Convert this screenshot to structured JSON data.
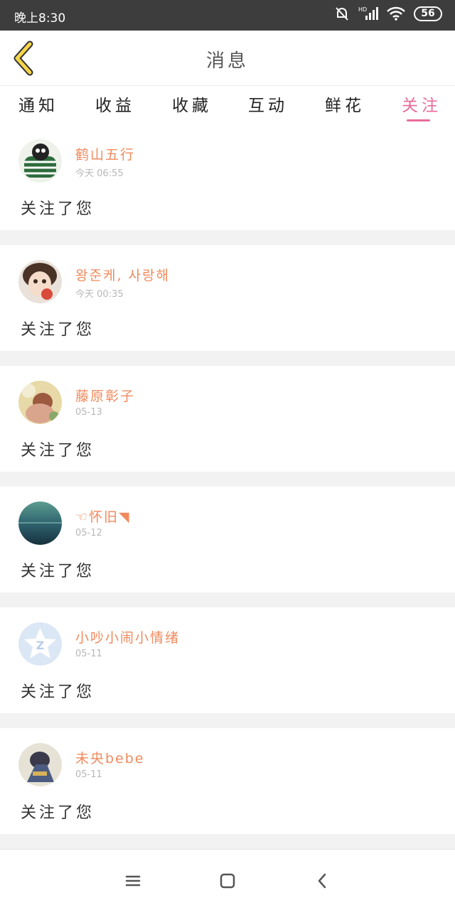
{
  "status_bar": {
    "time": "晚上8:30",
    "network": "HD",
    "battery": "56"
  },
  "header": {
    "title": "消息"
  },
  "tabs": [
    {
      "label": "通知"
    },
    {
      "label": "收益"
    },
    {
      "label": "收藏"
    },
    {
      "label": "互动"
    },
    {
      "label": "鲜花"
    },
    {
      "label": "关注",
      "active": true
    }
  ],
  "messages": [
    {
      "name": "鹤山五行",
      "time": "今天 06:55",
      "action": "关注了您"
    },
    {
      "name": "왕준케, 사랑해",
      "time": "今天 00:35",
      "action": "关注了您"
    },
    {
      "name": "藤原彰子",
      "time": "05-13",
      "action": "关注了您"
    },
    {
      "name": "☜怀旧◥",
      "time": "05-12",
      "action": "关注了您"
    },
    {
      "name": "小吵小闹小情绪",
      "time": "05-11",
      "action": "关注了您"
    },
    {
      "name": "未央bebe",
      "time": "05-11",
      "action": "关注了您"
    }
  ],
  "colors": {
    "accent": "#e86c9b",
    "name": "#f08a5d",
    "status_bar": "#3d3d3d",
    "back_icon": "#f5d54b"
  },
  "icons": [
    "back-arrow-icon",
    "mute-icon",
    "signal-icon",
    "wifi-icon",
    "menu-icon",
    "home-icon",
    "back-icon"
  ]
}
